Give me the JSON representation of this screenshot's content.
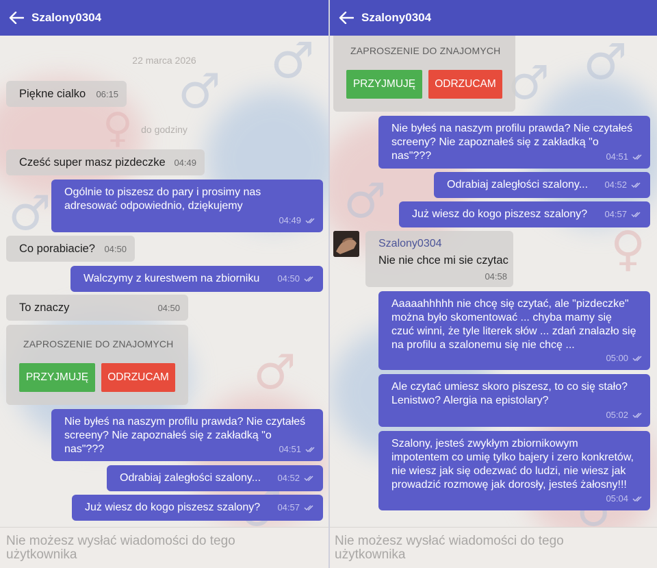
{
  "colors": {
    "topbar": "#4a4fbd",
    "outgoing_bubble": "#5b5cc9",
    "incoming_bubble": "#d2d0ce",
    "accept_button": "#4caf50",
    "reject_button": "#e74c3c"
  },
  "header": {
    "title": "Szalony0304",
    "back_icon": "arrow-left-icon"
  },
  "left": {
    "date_label": "22 marca 2026",
    "separator_label": "do godziny",
    "messages": [
      {
        "text": "Piękne cialko",
        "time": "06:15"
      },
      {
        "text": "Cześć super masz pizdeczke",
        "time": "04:49"
      },
      {
        "text": "Ogólnie to piszesz do pary i prosimy nas\nadresować odpowiednio, dziękujemy",
        "time": "04:49"
      },
      {
        "text": "Co porabiacie?",
        "time": "04:50"
      },
      {
        "text": "Walczymy z kurestwem na zbiorniku",
        "time": "04:50"
      },
      {
        "text": "To znaczy",
        "time": "04:50"
      },
      {
        "text": "Nie byłeś na naszym profilu prawda? Nie czytałeś\nscreeny? Nie zapoznałeś się z zakładką \"o nas\"???",
        "time": "04:51"
      },
      {
        "text": "Odrabiaj zaległości szalony...",
        "time": "04:52"
      },
      {
        "text": "Już wiesz do kogo piszesz szalony?",
        "time": "04:57"
      }
    ]
  },
  "invite": {
    "title": "ZAPROSZENIE DO ZNAJOMYCH",
    "accept_label": "PRZYJMUJĘ",
    "reject_label": "ODRZUCAM"
  },
  "right": {
    "messages": [
      {
        "text": "Nie byłeś na naszym profilu prawda? Nie czytałeś\nscreeny? Nie zapoznałeś się z zakładką \"o nas\"???",
        "time": "04:51"
      },
      {
        "text": "Odrabiaj zaległości szalony...",
        "time": "04:52"
      },
      {
        "text": "Już wiesz do kogo piszesz szalony?",
        "time": "04:57"
      },
      {
        "sender": "Szalony0304",
        "text": "Nie nie chce mi sie czytac",
        "time": "04:58"
      },
      {
        "text": "Aaaaahhhhh nie chcę się czytać, ale \"pizdeczke\"\nmożna było skomentować ... chyba mamy się\nczuć winni, że tyle literek słów ... zdań znalazło się\nna profilu a szalonemu się nie chcę ...",
        "time": "05:00"
      },
      {
        "text": "Ale czytać umiesz skoro piszesz, to co się stało?\nLenistwo? Alergia na epistolary?",
        "time": "05:02"
      },
      {
        "text": "Szalony, jesteś zwykłym zbiornikowym\nimpotentem co umię tylko bajery i zero konkretów,\nnie wiesz jak się odezwać do ludzi, nie wiesz jak\nprowadzić rozmowę jak dorosły, jesteś żałosny!!!",
        "time": "05:04"
      }
    ]
  },
  "footer": {
    "notice": "Nie możesz wysłać wiadomości do tego\nużytkownika"
  }
}
